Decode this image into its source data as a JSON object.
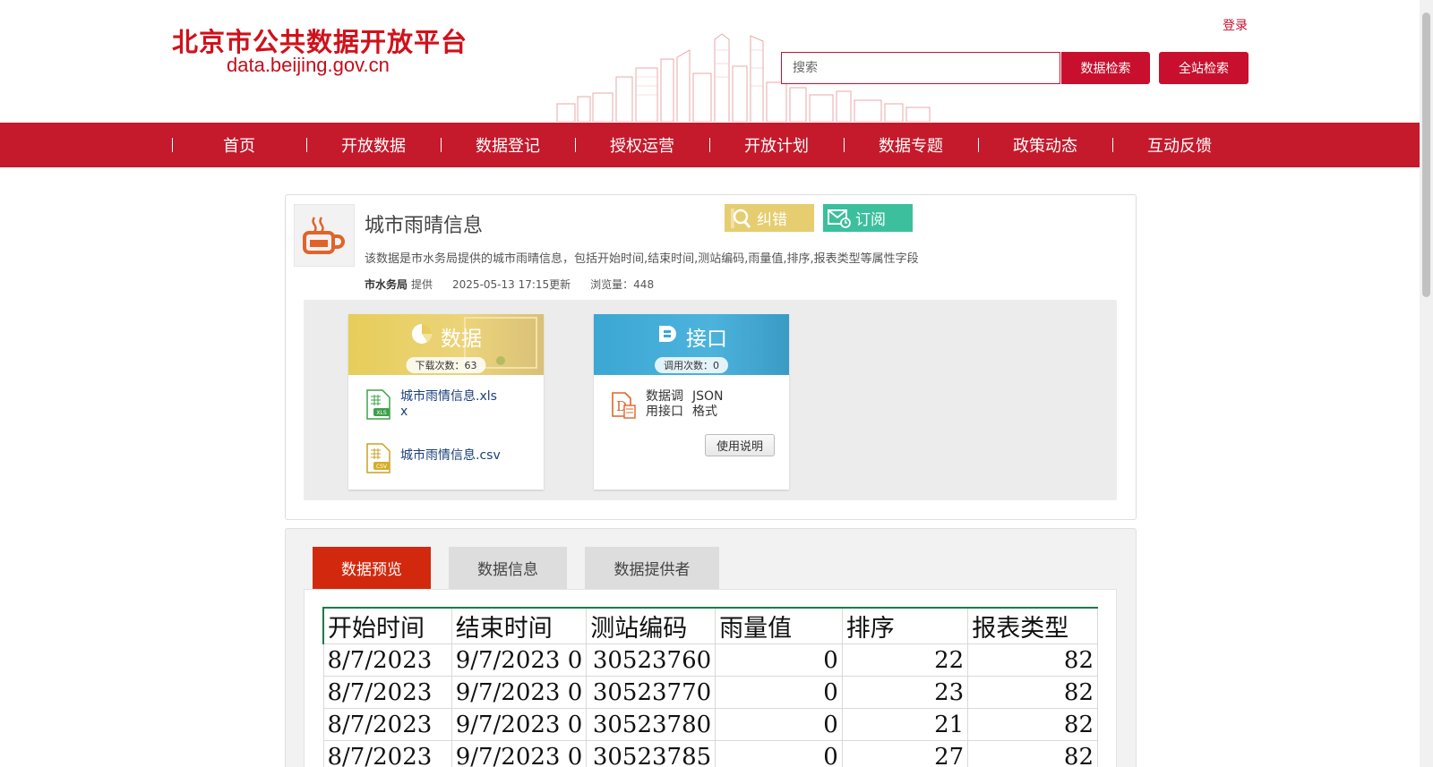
{
  "header": {
    "site_title": "北京市公共数据开放平台",
    "site_url": "data.beijing.gov.cn",
    "login_label": "登录",
    "search_placeholder": "搜索",
    "data_search_label": "数据检索",
    "site_search_label": "全站检索"
  },
  "nav": {
    "items": [
      "首页",
      "开放数据",
      "数据登记",
      "授权运营",
      "开放计划",
      "数据专题",
      "政策动态",
      "互动反馈"
    ]
  },
  "dataset": {
    "title": "城市雨晴信息",
    "description": "该数据是市水务局提供的城市雨晴信息，包括开始时间,结束时间,测站编码,雨量值,排序,报表类型等属性字段",
    "provider": "市水务局",
    "provider_suffix": "提供",
    "updated": "2025-05-13 17:15更新",
    "views": "浏览量：448",
    "correct_label": "纠错",
    "subscribe_label": "订阅"
  },
  "resources": {
    "data_title": "数据",
    "download_count": "下载次数：63",
    "files": [
      "城市雨情信息.xlsx",
      "城市雨情信息.csv"
    ],
    "api_title": "接口",
    "call_count": "调用次数：0",
    "api_name": "数据调用接口",
    "api_format": "JSON格式",
    "usage_label": "使用说明"
  },
  "tabs": {
    "items": [
      "数据预览",
      "数据信息",
      "数据提供者"
    ]
  },
  "preview": {
    "columns": [
      "开始时间",
      "结束时间",
      "测站编码",
      "雨量值",
      "排序",
      "报表类型"
    ],
    "rows": [
      [
        "8/7/2023",
        "9/7/2023 0",
        "30523760",
        "0",
        "22",
        "82"
      ],
      [
        "8/7/2023",
        "9/7/2023 0",
        "30523770",
        "0",
        "23",
        "82"
      ],
      [
        "8/7/2023",
        "9/7/2023 0",
        "30523780",
        "0",
        "21",
        "82"
      ],
      [
        "8/7/2023",
        "9/7/2023 0",
        "30523785",
        "0",
        "27",
        "82"
      ]
    ]
  },
  "colors": {
    "brand_red": "#c41a2c",
    "tab_active": "#d2290e",
    "correct_btn": "#e6cd6f",
    "subscribe_btn": "#3bbf9c"
  }
}
